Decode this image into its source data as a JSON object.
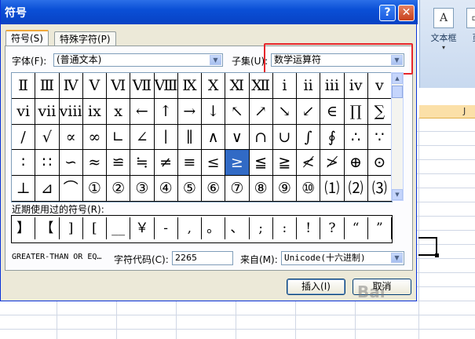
{
  "dialog": {
    "title": "符号",
    "help_label": "?",
    "close_label": "✕",
    "tabs": [
      {
        "label": "符号(S)",
        "active": true
      },
      {
        "label": "特殊字符(P)",
        "active": false
      }
    ],
    "font_label": "字体(F):",
    "font_value": "(普通文本)",
    "subset_label": "子集(U):",
    "subset_value": "数学运算符",
    "symbol_rows": [
      [
        "Ⅱ",
        "Ⅲ",
        "Ⅳ",
        "Ⅴ",
        "Ⅵ",
        "Ⅶ",
        "Ⅷ",
        "Ⅸ",
        "Ⅹ",
        "Ⅺ",
        "Ⅻ",
        "ⅰ",
        "ⅱ",
        "ⅲ",
        "ⅳ",
        "ⅴ"
      ],
      [
        "ⅵ",
        "ⅶ",
        "ⅷ",
        "ⅸ",
        "ⅹ",
        "←",
        "↑",
        "→",
        "↓",
        "↖",
        "↗",
        "↘",
        "↙",
        "∈",
        "∏",
        "∑"
      ],
      [
        "∕",
        "√",
        "∝",
        "∞",
        "∟",
        "∠",
        "∣",
        "∥",
        "∧",
        "∨",
        "∩",
        "∪",
        "∫",
        "∮",
        "∴",
        "∵"
      ],
      [
        "∶",
        "∷",
        "∽",
        "≈",
        "≌",
        "≒",
        "≠",
        "≡",
        "≤",
        "≥",
        "≦",
        "≧",
        "≮",
        "≯",
        "⊕",
        "⊙"
      ],
      [
        "⊥",
        "⊿",
        "⌒",
        "①",
        "②",
        "③",
        "④",
        "⑤",
        "⑥",
        "⑦",
        "⑧",
        "⑨",
        "⑩",
        "⑴",
        "⑵",
        "⑶"
      ]
    ],
    "selected_symbol_index": [
      3,
      9
    ],
    "recent_label": "近期使用过的符号(R):",
    "recent_symbols": [
      "】",
      "【",
      "]",
      "[",
      "__",
      "￥",
      "-",
      ",",
      "。",
      "、",
      ";",
      ":",
      "!",
      "?",
      "“",
      "”"
    ],
    "char_name": "GREATER-THAN OR EQ…",
    "char_code_label": "字符代码(C):",
    "char_code_value": "2265",
    "from_label": "来自(M):",
    "from_value": "Unicode(十六进制)",
    "insert_button": "插入(I)",
    "cancel_button": "取消"
  },
  "excel": {
    "ribbon_buttons": [
      {
        "label": "文本框",
        "icon_glyph": "A"
      },
      {
        "label": "页",
        "icon_glyph": "▭"
      }
    ],
    "column_header": "J"
  },
  "watermark_text": "Bai"
}
